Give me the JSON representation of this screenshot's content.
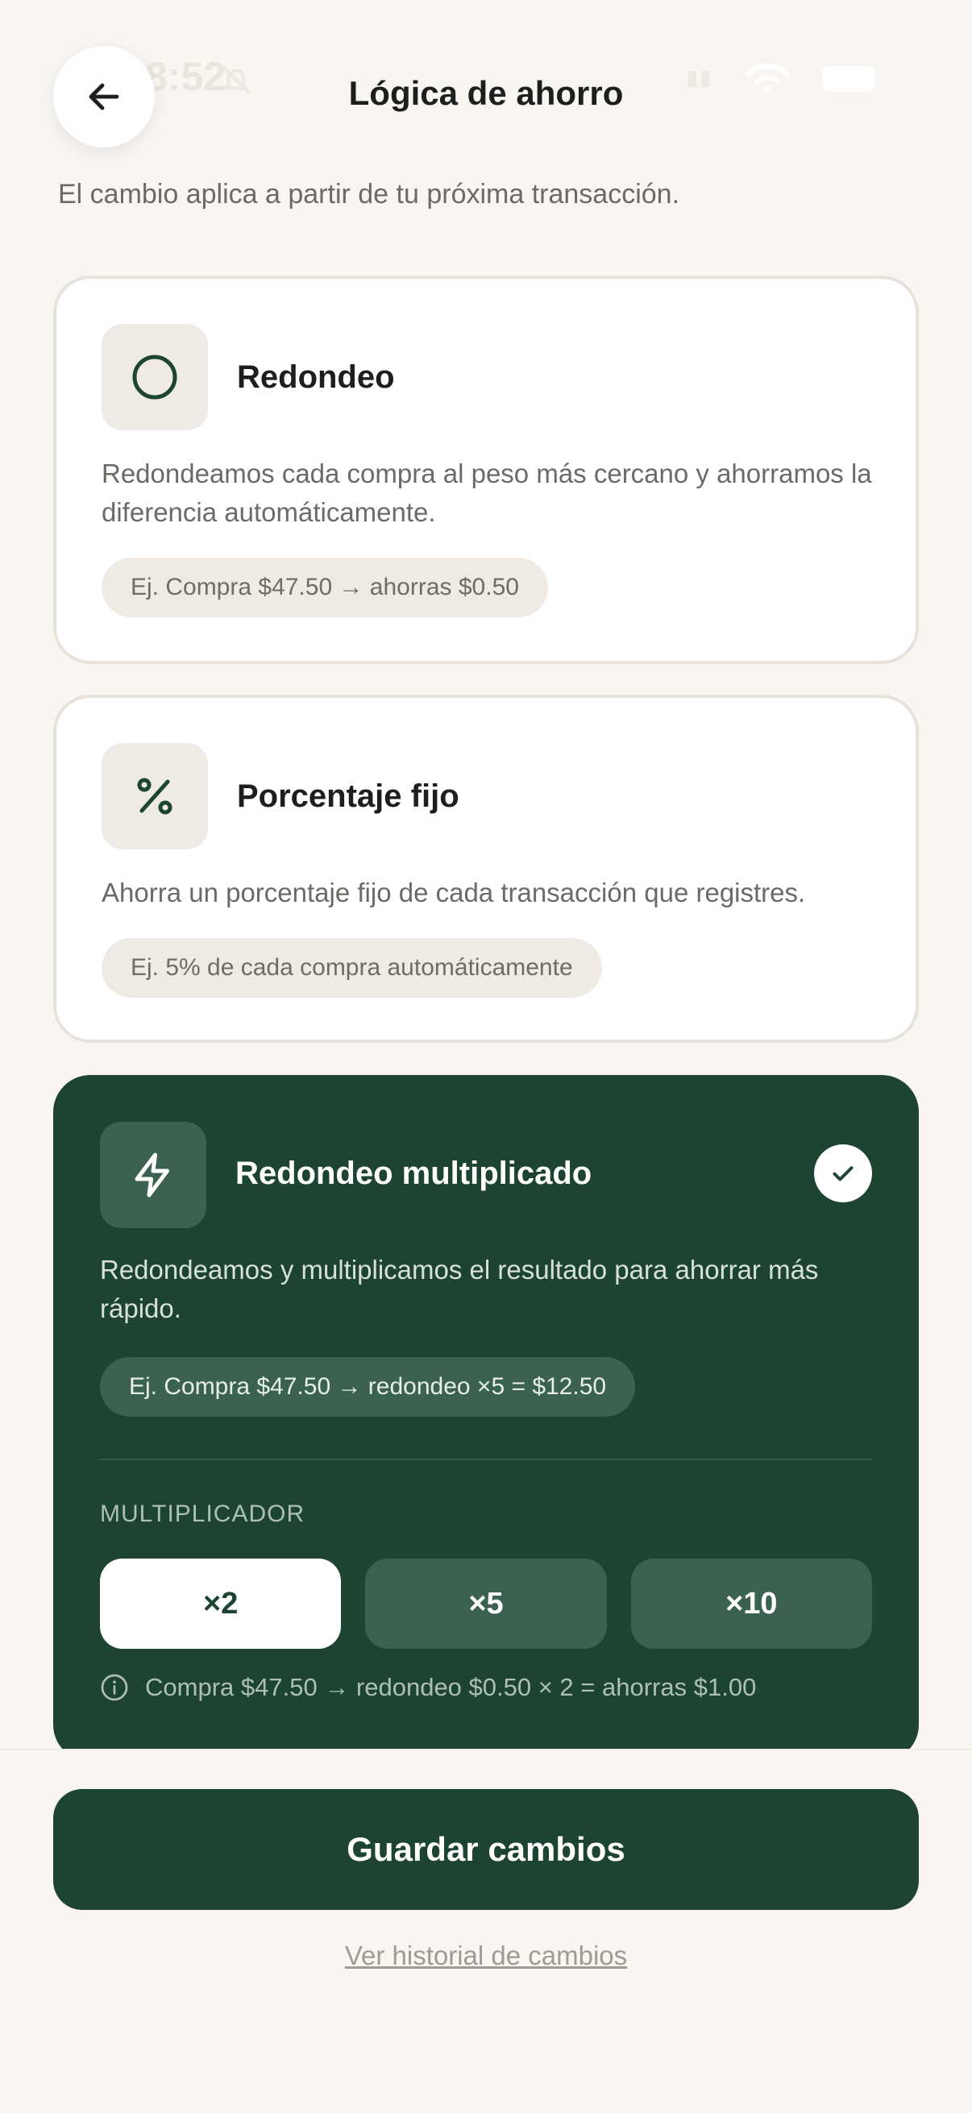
{
  "status_bar": {
    "time": "8:52"
  },
  "header": {
    "title": "Lógica de ahorro",
    "back_icon": "arrow-left-icon"
  },
  "subtitle": "El cambio aplica a partir de tu próxima transacción.",
  "options": [
    {
      "icon": "circle-icon",
      "title": "Redondeo",
      "description": "Redondeamos cada compra al peso más cercano y ahorramos la diferencia automáticamente.",
      "example": "Ej. Compra $47.50 → ahorras $0.50",
      "selected": false
    },
    {
      "icon": "percent-icon",
      "title": "Porcentaje fijo",
      "description": "Ahorra un porcentaje fijo de cada transacción que registres.",
      "example": "Ej. 5% de cada compra automáticamente",
      "selected": false
    },
    {
      "icon": "lightning-icon",
      "title": "Redondeo multiplicado",
      "description": "Redondeamos y multiplicamos el resultado para ahorrar más rápido.",
      "example": "Ej. Compra $47.50 → redondeo ×5 = $12.50",
      "selected": true
    }
  ],
  "multiplier": {
    "label": "MULTIPLICADOR",
    "options": [
      "×2",
      "×5",
      "×10"
    ],
    "selected": "×2",
    "info": "Compra $47.50 → redondeo $0.50 × 2 = ahorras $1.00"
  },
  "footer": {
    "save_label": "Guardar cambios",
    "history_label": "Ver historial de cambios"
  },
  "colors": {
    "background": "#f9f6f1",
    "primary": "#1c4431",
    "primary_soft": "#3b6250",
    "card_border": "#e7e3dc",
    "pill_bg": "#efebe4"
  }
}
